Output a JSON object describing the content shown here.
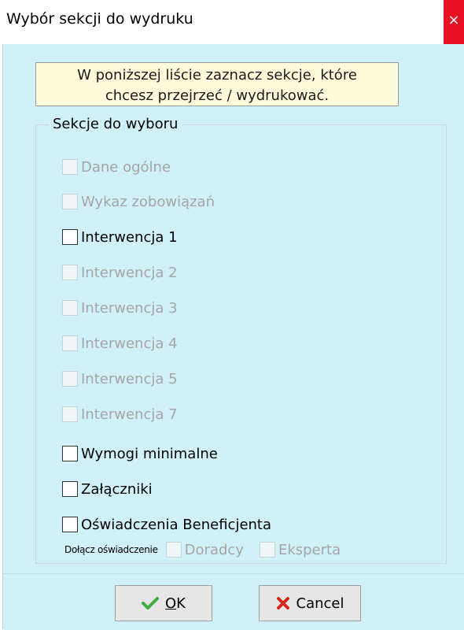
{
  "window": {
    "title": "Wybór sekcji do wydruku",
    "close_glyph": "×"
  },
  "info": {
    "line1": "W poniższej liście zaznacz sekcje, które",
    "line2": "chcesz przejrzeć / wydrukować."
  },
  "group": {
    "legend": "Sekcje do wyboru"
  },
  "sections": [
    {
      "label": "Dane ogólne",
      "enabled": false,
      "checked": false
    },
    {
      "label": "Wykaz zobowiązań",
      "enabled": false,
      "checked": false
    },
    {
      "label": "Interwencja 1",
      "enabled": true,
      "checked": false
    },
    {
      "label": "Interwencja 2",
      "enabled": false,
      "checked": false
    },
    {
      "label": "Interwencja 3",
      "enabled": false,
      "checked": false
    },
    {
      "label": "Interwencja 4",
      "enabled": false,
      "checked": false
    },
    {
      "label": "Interwencja 5",
      "enabled": false,
      "checked": false
    },
    {
      "label": "Interwencja 7",
      "enabled": false,
      "checked": false
    },
    {
      "label": "Wymogi minimalne",
      "enabled": true,
      "checked": false
    },
    {
      "label": "Załączniki",
      "enabled": true,
      "checked": false
    },
    {
      "label": "Oświadczenia Beneficjenta",
      "enabled": true,
      "checked": false
    }
  ],
  "attach": {
    "label": "Dołącz oświadczenie",
    "options": [
      {
        "label": "Doradcy",
        "enabled": false,
        "checked": false
      },
      {
        "label": "Eksperta",
        "enabled": false,
        "checked": false
      }
    ]
  },
  "buttons": {
    "ok_mnemonic": "O",
    "ok_rest": "K",
    "cancel_label": "Cancel"
  },
  "colors": {
    "client_bg": "#d0f1f8",
    "info_bg": "#fffcdc",
    "close_bg": "#e81123",
    "ok_icon": "#44a844",
    "cancel_icon": "#d42a1c",
    "disabled_text": "#a5a5a5"
  },
  "icons": {
    "ok": "checkmark-icon",
    "cancel": "x-cross-icon"
  }
}
